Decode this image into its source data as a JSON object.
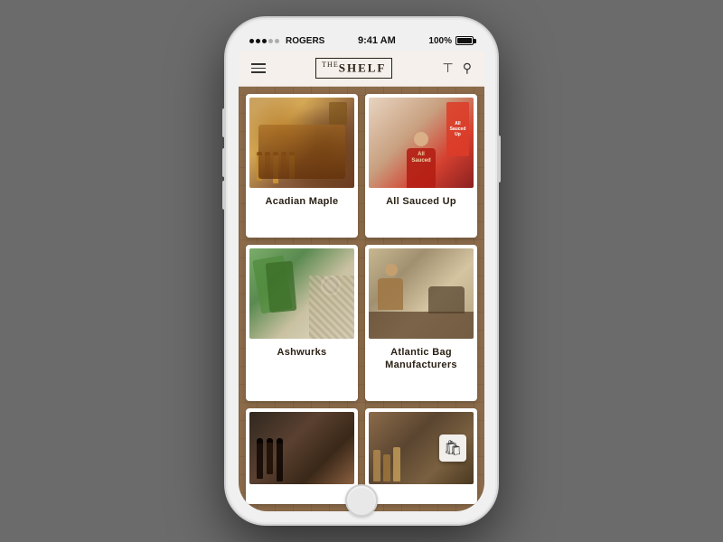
{
  "phone": {
    "status": {
      "carrier": "ROGERS",
      "time": "9:41 AM",
      "battery": "100%"
    },
    "nav": {
      "logo_prefix": "THE",
      "logo_main": "SHELF",
      "hamburger_label": "Menu"
    },
    "grid": {
      "items": [
        {
          "id": "acadian-maple",
          "label": "Acadian Maple",
          "image_type": "acadian"
        },
        {
          "id": "all-sauced-up",
          "label": "All Sauced Up",
          "image_type": "sauced"
        },
        {
          "id": "ashwurks",
          "label": "Ashwurks",
          "image_type": "ashwurks"
        },
        {
          "id": "atlantic-bag",
          "label": "Atlantic Bag Manufacturers",
          "image_type": "atlantic"
        },
        {
          "id": "item5",
          "label": "",
          "image_type": "bottom1"
        },
        {
          "id": "item6",
          "label": "",
          "image_type": "bottom2"
        }
      ]
    }
  }
}
